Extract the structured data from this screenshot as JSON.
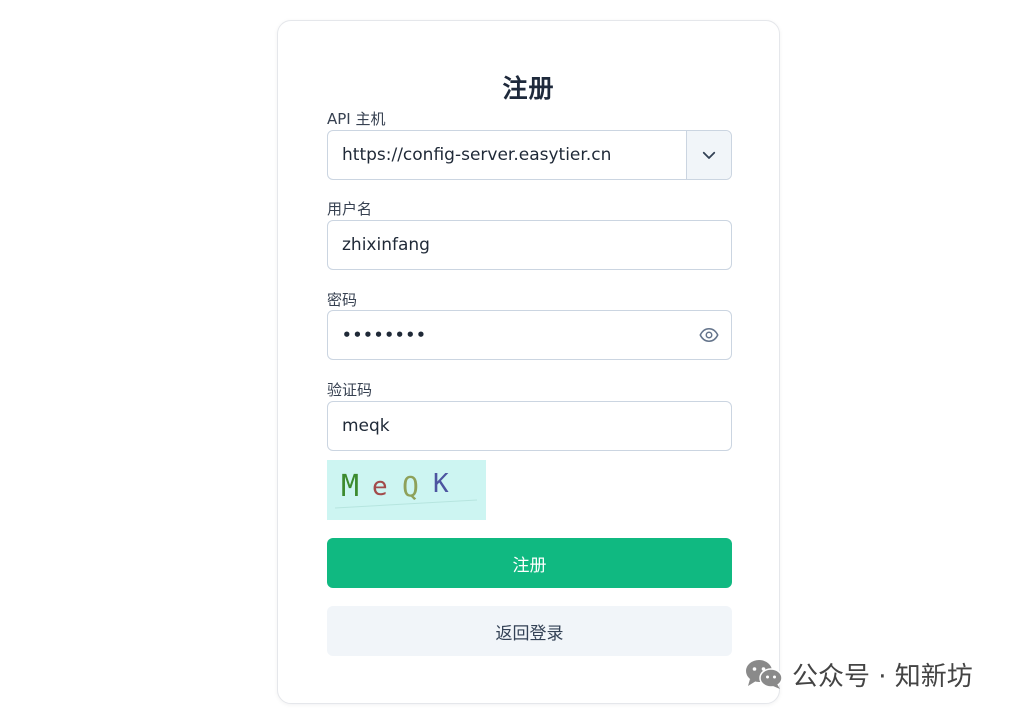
{
  "form": {
    "title": "注册",
    "api_host_label": "API 主机",
    "api_host_value": "https://config-server.easytier.cn",
    "username_label": "用户名",
    "username_value": "zhixinfang",
    "password_label": "密码",
    "password_value": "••••••••",
    "captcha_label": "验证码",
    "captcha_value": "meqk",
    "captcha_image_text": [
      "M",
      "e",
      "Q",
      "K"
    ],
    "register_button": "注册",
    "back_to_login_button": "返回登录"
  },
  "watermark": {
    "text": "公众号 · 知新坊"
  },
  "colors": {
    "primary": "#10b981",
    "secondary_bg": "#f1f5f9",
    "captcha_bg": "#cdf5f2"
  },
  "icons": {
    "dropdown": "chevron-down-icon",
    "password_toggle": "eye-icon",
    "watermark": "wechat-icon"
  }
}
